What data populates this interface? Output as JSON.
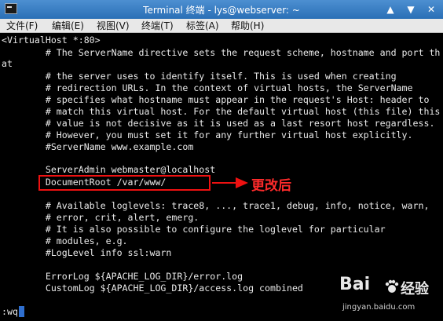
{
  "window": {
    "title": "Terminal 终端 - lys@webserver: ~",
    "minimize_glyph": "▲",
    "maximize_glyph": "▼",
    "close_glyph": "✕"
  },
  "menu": [
    "文件(F)",
    "编辑(E)",
    "视图(V)",
    "终端(T)",
    "标签(A)",
    "帮助(H)"
  ],
  "terminal_lines": [
    "<VirtualHost *:80>",
    "        # The ServerName directive sets the request scheme, hostname and port th",
    "at",
    "        # the server uses to identify itself. This is used when creating",
    "        # redirection URLs. In the context of virtual hosts, the ServerName",
    "        # specifies what hostname must appear in the request's Host: header to",
    "        # match this virtual host. For the default virtual host (this file) this",
    "        # value is not decisive as it is used as a last resort host regardless.",
    "        # However, you must set it for any further virtual host explicitly.",
    "        #ServerName www.example.com",
    "",
    "        ServerAdmin webmaster@localhost",
    "        DocumentRoot /var/www/",
    "",
    "        # Available loglevels: trace8, ..., trace1, debug, info, notice, warn,",
    "        # error, crit, alert, emerg.",
    "        # It is also possible to configure the loglevel for particular",
    "        # modules, e.g.",
    "        #LogLevel info ssl:warn",
    "",
    "        ErrorLog ${APACHE_LOG_DIR}/error.log",
    "        CustomLog ${APACHE_LOG_DIR}/access.log combined",
    "",
    "",
    ":wq"
  ],
  "annotation": {
    "text": "更改后",
    "color": "#ff2b2b"
  },
  "watermark": {
    "logo": "Bai",
    "text": "经验",
    "url": "jingyan.baidu.com"
  },
  "colors": {
    "titlebar": "#3b7fc4",
    "terminal_bg": "#000000",
    "terminal_fg": "#eaeaea",
    "cursor": "#2f6fcf"
  }
}
